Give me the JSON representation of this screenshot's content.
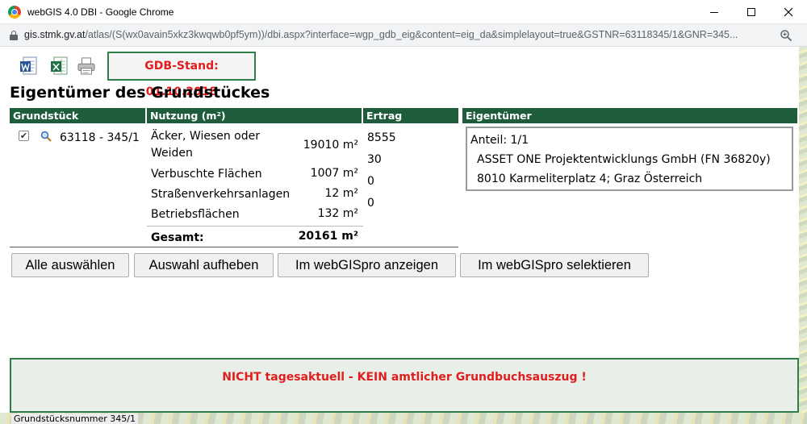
{
  "window": {
    "title": "webGIS 4.0 DBI - Google Chrome"
  },
  "address": {
    "host": "gis.stmk.gv.at",
    "path": "/atlas/(S(wx0avain5xkz3kwqwb0pf5ym))/dbi.aspx?interface=wgp_gdb_eig&content=eig_da&simplelayout=true&GSTNR=63118345/1&GNR=345..."
  },
  "toolbar": {
    "gdb_stand": "GDB-Stand: 01.10.2018"
  },
  "page": {
    "title": "Eigentümer des Grundstückes"
  },
  "table": {
    "headers": {
      "grundstueck": "Grundstück",
      "nutzung": "Nutzung (m²)",
      "ertrag": "Ertrag",
      "eigentuemer": "Eigentümer"
    },
    "parcel": "63118 - 345/1",
    "checked_mark": "✔",
    "nutzung": [
      {
        "label_1": "Äcker, Wiesen oder",
        "label_2": "Weiden",
        "value": "19010 m²"
      },
      {
        "label": "Verbuschte Flächen",
        "value": "1007 m²"
      },
      {
        "label": "Straßenverkehrsanlagen",
        "value": "12 m²"
      },
      {
        "label": "Betriebsflächen",
        "value": "132 m²"
      }
    ],
    "ertrag": [
      "8555",
      "30",
      "0",
      "0"
    ],
    "total_label": "Gesamt:",
    "total_value": "20161 m²"
  },
  "owner": {
    "share": "Anteil: 1/1",
    "name": "ASSET ONE Projektentwicklungs GmbH (FN 36820y)",
    "address": "8010 Karmeliterplatz 4; Graz Österreich"
  },
  "buttons": {
    "select_all": "Alle auswählen",
    "clear_selection": "Auswahl aufheben",
    "show_webgispro": "Im webGISpro anzeigen",
    "select_webgispro": "Im webGISpro selektieren"
  },
  "warning": "NICHT tagesaktuell - KEIN amtlicher Grundbuchsauszug !",
  "background_label": "Grundstücksnummer 345/1"
}
